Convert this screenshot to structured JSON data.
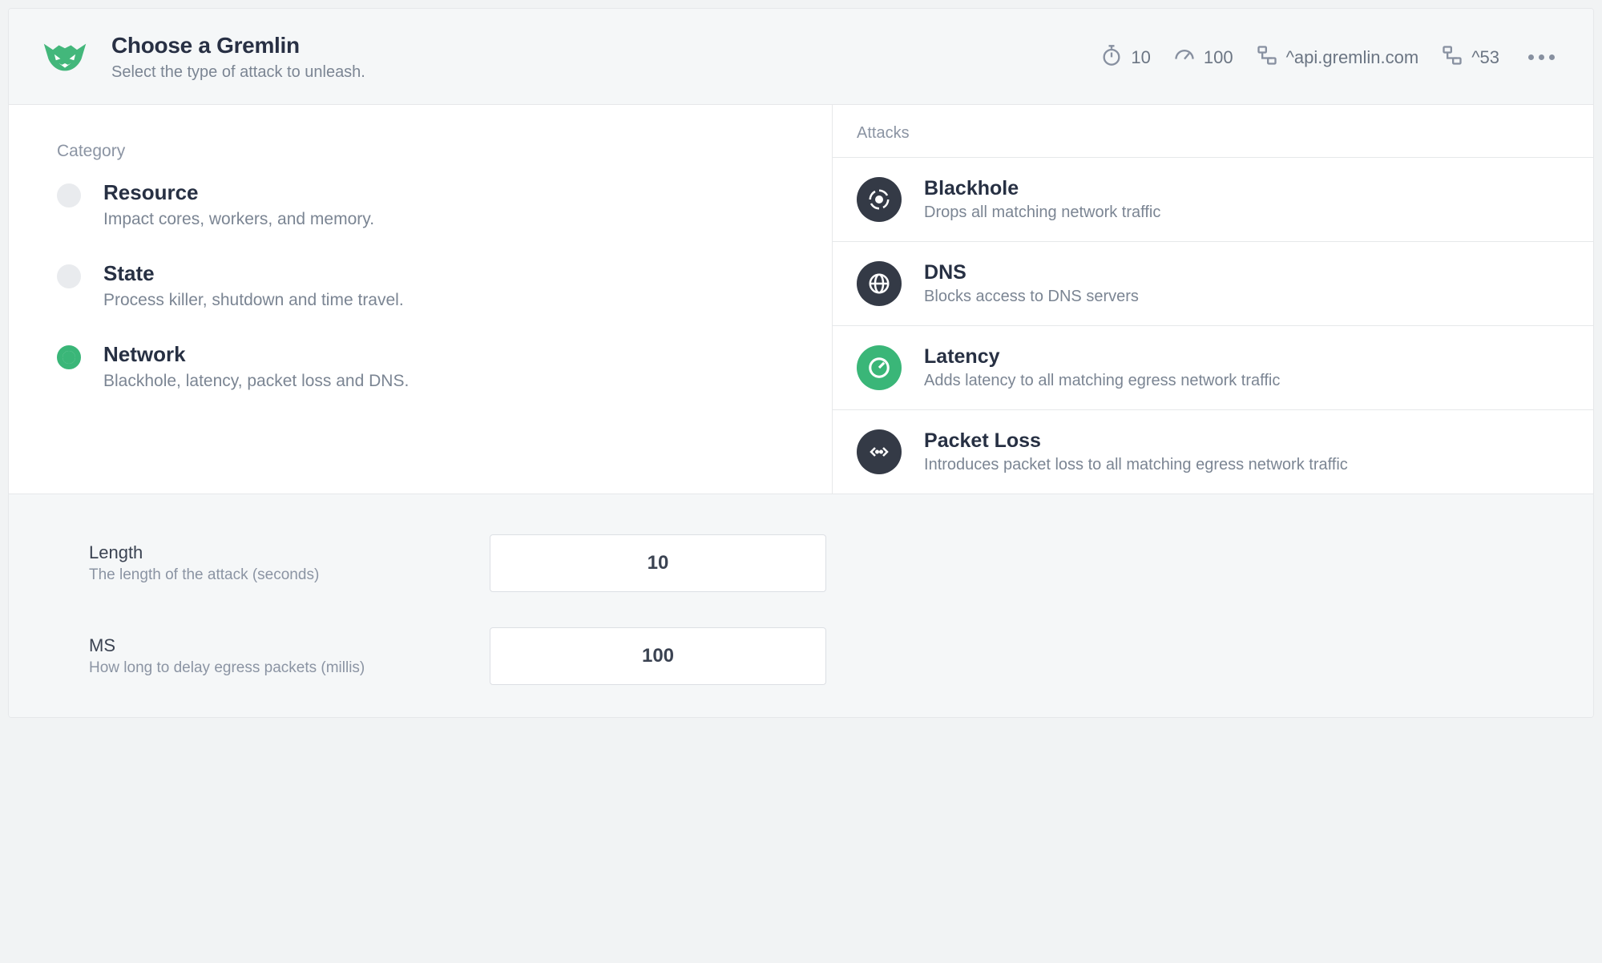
{
  "header": {
    "title": "Choose a Gremlin",
    "subtitle": "Select the type of attack to unleash.",
    "params": {
      "duration": "10",
      "ms": "100",
      "host": "^api.gremlin.com",
      "port": "^53"
    }
  },
  "categories": {
    "label": "Category",
    "items": [
      {
        "title": "Resource",
        "desc": "Impact cores, workers, and memory.",
        "selected": false
      },
      {
        "title": "State",
        "desc": "Process killer, shutdown and time travel.",
        "selected": false
      },
      {
        "title": "Network",
        "desc": "Blackhole, latency, packet loss and DNS.",
        "selected": true
      }
    ]
  },
  "attacks": {
    "label": "Attacks",
    "items": [
      {
        "title": "Blackhole",
        "desc": "Drops all matching network traffic"
      },
      {
        "title": "DNS",
        "desc": "Blocks access to DNS servers"
      },
      {
        "title": "Latency",
        "desc": "Adds latency to all matching egress network traffic"
      },
      {
        "title": "Packet Loss",
        "desc": "Introduces packet loss to all matching egress network traffic"
      }
    ]
  },
  "form": {
    "length": {
      "label": "Length",
      "help": "The length of the attack (seconds)",
      "value": "10"
    },
    "ms": {
      "label": "MS",
      "help": "How long to delay egress packets (millis)",
      "value": "100"
    }
  }
}
